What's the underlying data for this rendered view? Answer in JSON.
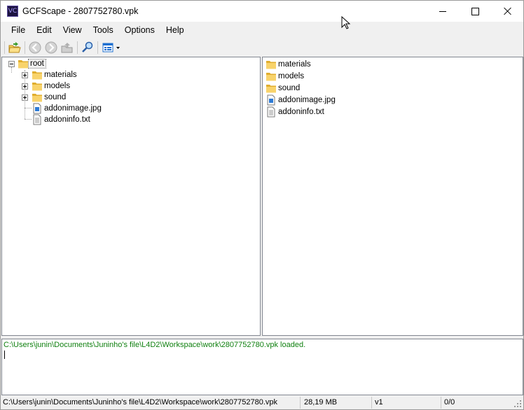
{
  "window": {
    "title": "GCFScape - 2807752780.vpk",
    "app_icon_text": "VC"
  },
  "menu": [
    "File",
    "Edit",
    "View",
    "Tools",
    "Options",
    "Help"
  ],
  "toolbar": {
    "icons": [
      "open-folder-icon",
      "back-arrow-icon",
      "forward-arrow-icon",
      "up-folder-icon",
      "search-icon",
      "view-mode-icon",
      "dropdown-arrow-icon"
    ]
  },
  "tree": {
    "root_label": "root",
    "children": [
      {
        "label": "materials",
        "type": "folder"
      },
      {
        "label": "models",
        "type": "folder"
      },
      {
        "label": "sound",
        "type": "folder"
      },
      {
        "label": "addonimage.jpg",
        "type": "image"
      },
      {
        "label": "addoninfo.txt",
        "type": "text"
      }
    ]
  },
  "list": {
    "items": [
      {
        "label": "materials",
        "type": "folder"
      },
      {
        "label": "models",
        "type": "folder"
      },
      {
        "label": "sound",
        "type": "folder"
      },
      {
        "label": "addonimage.jpg",
        "type": "image"
      },
      {
        "label": "addoninfo.txt",
        "type": "text"
      }
    ]
  },
  "console": {
    "message": "C:\\Users\\junin\\Documents\\Juninho's file\\L4D2\\Workspace\\work\\2807752780.vpk loaded.",
    "message_color": "#108010"
  },
  "status": {
    "path": "C:\\Users\\junin\\Documents\\Juninho's file\\L4D2\\Workspace\\work\\2807752780.vpk",
    "size": "28,19 MB",
    "version": "v1",
    "count": "0/0"
  },
  "colors": {
    "folder": "#f8d36b",
    "folder_dark": "#e0ad2e",
    "accent_blue": "#1e6fd0"
  }
}
